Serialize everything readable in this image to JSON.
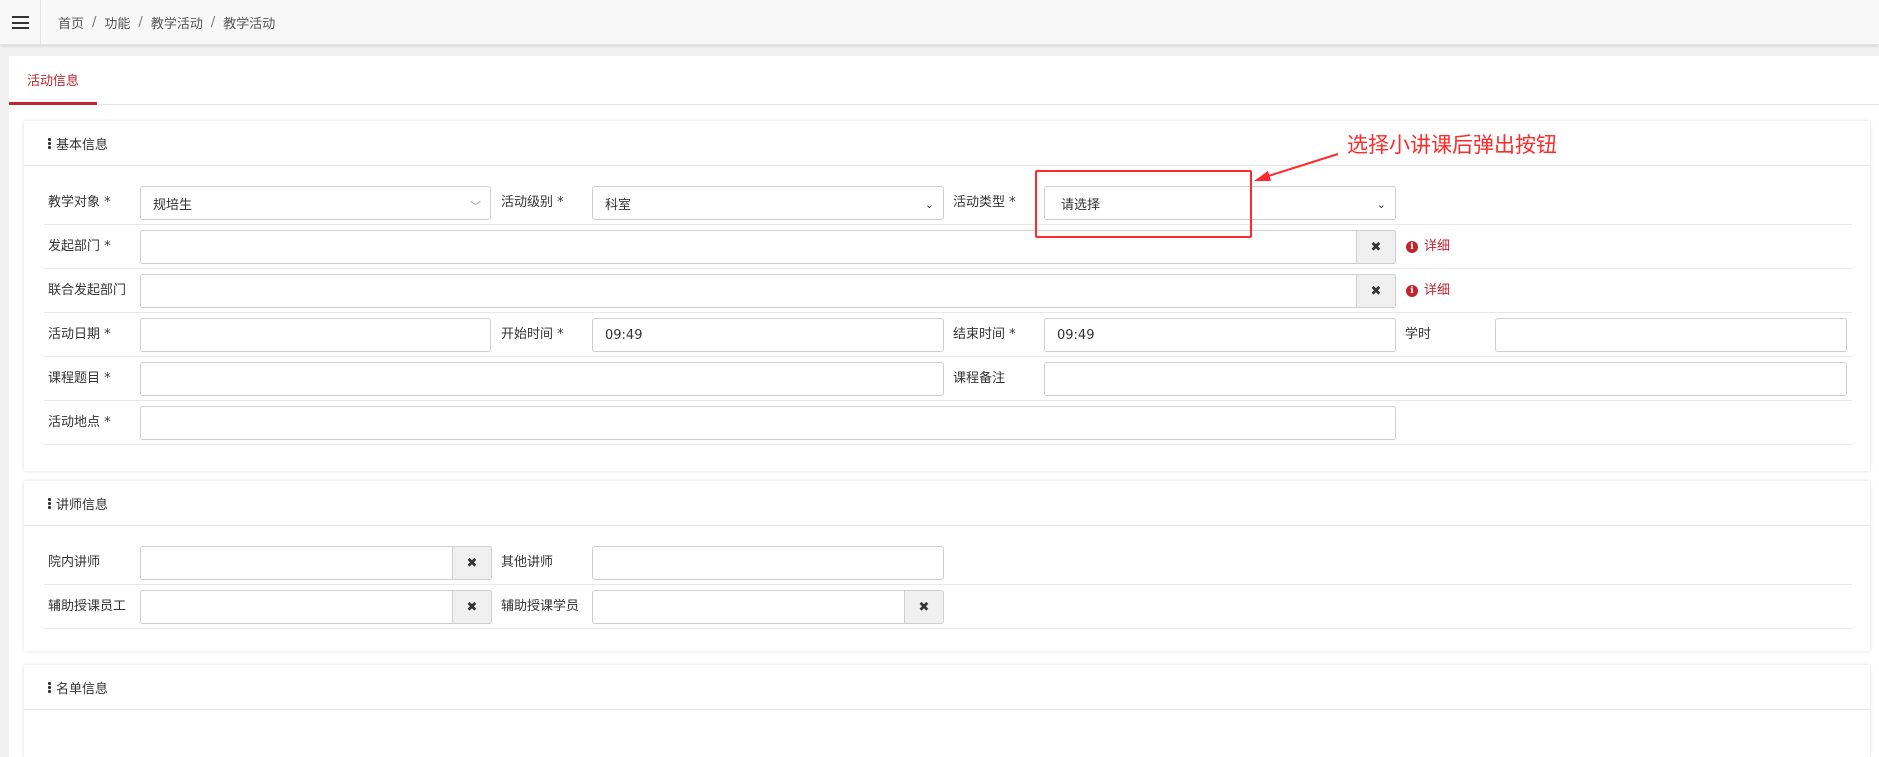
{
  "breadcrumb": [
    "首页",
    "功能",
    "教学活动",
    "教学活动"
  ],
  "tabs": [
    {
      "label": "活动信息"
    }
  ],
  "sections": {
    "basic": {
      "title": "基本信息",
      "teach_target": {
        "label": "教学对象 *",
        "value": "规培生"
      },
      "activity_level": {
        "label": "活动级别 *",
        "value": "科室"
      },
      "activity_type": {
        "label": "活动类型 *",
        "value": "请选择"
      },
      "origin_dept": {
        "label": "发起部门 *",
        "value": "",
        "detail": "详细"
      },
      "joint_dept": {
        "label": "联合发起部门",
        "value": "",
        "detail": "详细"
      },
      "activity_date": {
        "label": "活动日期 *",
        "value": ""
      },
      "start_time": {
        "label": "开始时间 *",
        "value": "09:49"
      },
      "end_time": {
        "label": "结束时间 *",
        "value": "09:49"
      },
      "hours": {
        "label": "学时",
        "value": ""
      },
      "course_title": {
        "label": "课程题目 *",
        "value": ""
      },
      "course_note": {
        "label": "课程备注",
        "value": ""
      },
      "location": {
        "label": "活动地点 *",
        "value": ""
      }
    },
    "lecturer": {
      "title": "讲师信息",
      "internal": {
        "label": "院内讲师",
        "value": ""
      },
      "other": {
        "label": "其他讲师",
        "value": ""
      },
      "assist_staff": {
        "label": "辅助授课员工",
        "value": ""
      },
      "assist_student": {
        "label": "辅助授课学员",
        "value": ""
      }
    },
    "roster": {
      "title": "名单信息"
    }
  },
  "annotation": {
    "text": "选择小讲课后弹出按钮",
    "color": "#ff2a2a"
  },
  "colors": {
    "accent": "#c0242e"
  },
  "icons": {
    "menu": "hamburger-icon",
    "clear": "close-icon",
    "info": "info-circle-icon",
    "dropdown": "chevron-down-icon"
  }
}
